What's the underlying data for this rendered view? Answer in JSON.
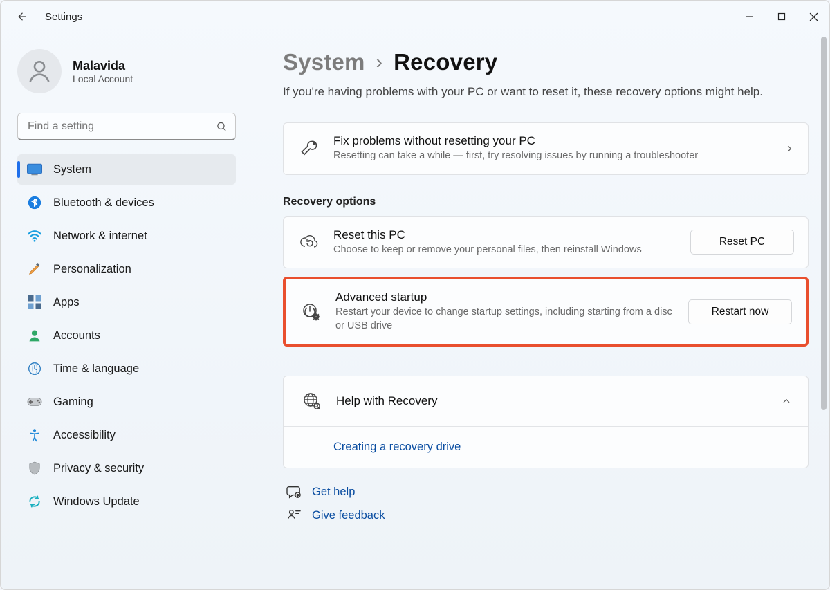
{
  "window": {
    "title": "Settings"
  },
  "profile": {
    "name": "Malavida",
    "account_type": "Local Account"
  },
  "search": {
    "placeholder": "Find a setting"
  },
  "sidebar": {
    "items": [
      {
        "label": "System"
      },
      {
        "label": "Bluetooth & devices"
      },
      {
        "label": "Network & internet"
      },
      {
        "label": "Personalization"
      },
      {
        "label": "Apps"
      },
      {
        "label": "Accounts"
      },
      {
        "label": "Time & language"
      },
      {
        "label": "Gaming"
      },
      {
        "label": "Accessibility"
      },
      {
        "label": "Privacy & security"
      },
      {
        "label": "Windows Update"
      }
    ]
  },
  "breadcrumb": {
    "parent": "System",
    "sep": "›",
    "current": "Recovery"
  },
  "intro": "If you're having problems with your PC or want to reset it, these recovery options might help.",
  "fixcard": {
    "title": "Fix problems without resetting your PC",
    "sub": "Resetting can take a while — first, try resolving issues by running a troubleshooter"
  },
  "section_label": "Recovery options",
  "resetcard": {
    "title": "Reset this PC",
    "sub": "Choose to keep or remove your personal files, then reinstall Windows",
    "button": "Reset PC"
  },
  "advcard": {
    "title": "Advanced startup",
    "sub": "Restart your device to change startup settings, including starting from a disc or USB drive",
    "button": "Restart now"
  },
  "help": {
    "title": "Help with Recovery",
    "link": "Creating a recovery drive"
  },
  "footer": {
    "get_help": "Get help",
    "feedback": "Give feedback"
  }
}
